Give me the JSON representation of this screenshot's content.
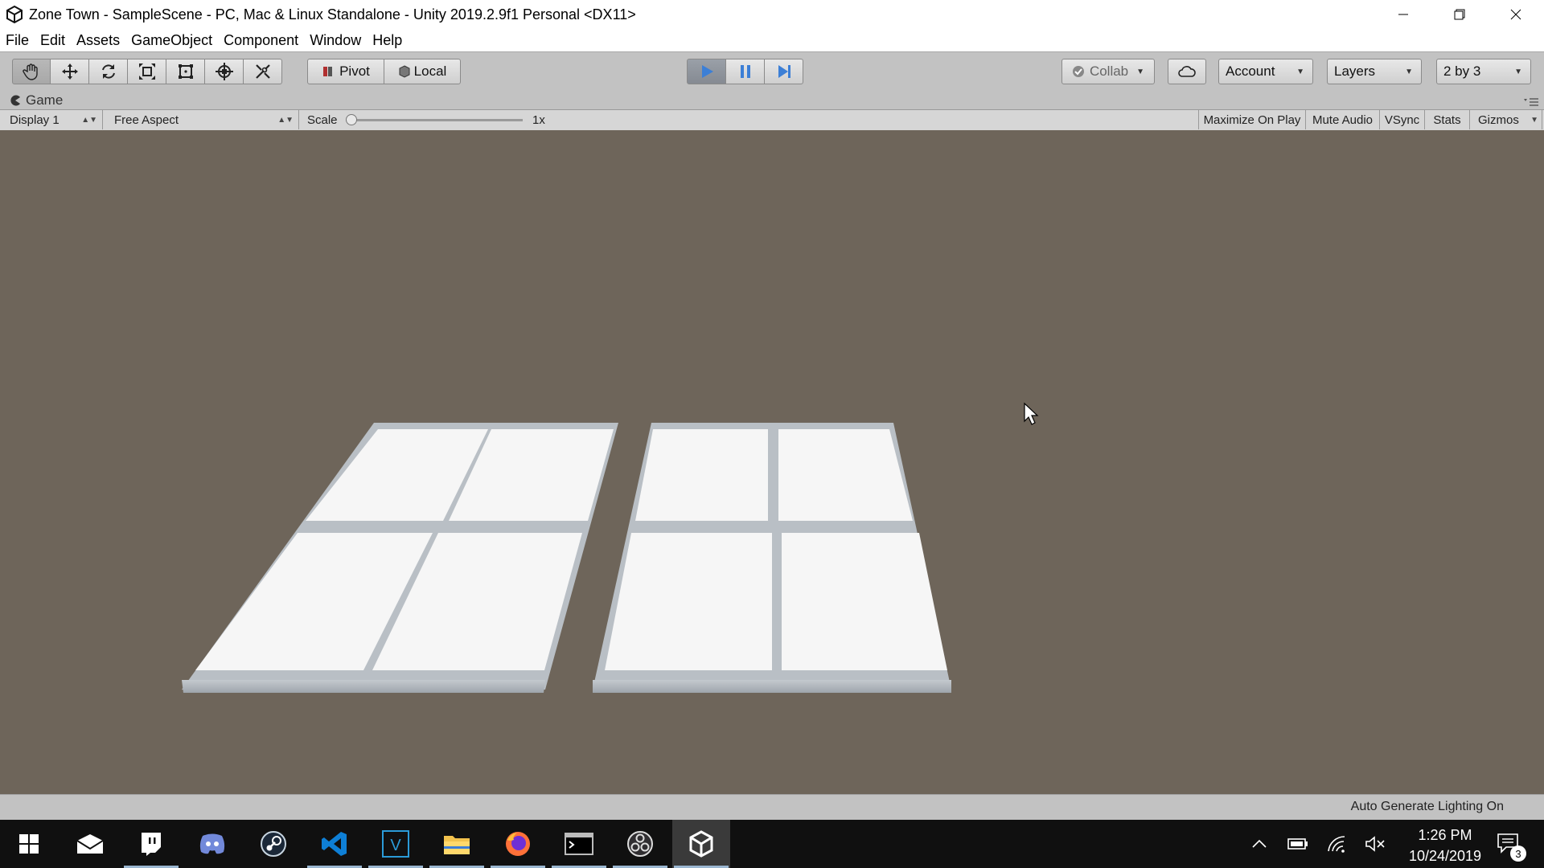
{
  "window": {
    "title": "Zone Town - SampleScene - PC, Mac & Linux Standalone - Unity 2019.2.9f1 Personal <DX11>",
    "controls": [
      "minimize-icon",
      "restore-icon",
      "close-icon"
    ]
  },
  "menu": [
    "File",
    "Edit",
    "Assets",
    "GameObject",
    "Component",
    "Window",
    "Help"
  ],
  "toolbar": {
    "tools": [
      "hand-tool-icon",
      "move-tool-icon",
      "rotate-tool-icon",
      "scale-tool-icon",
      "rect-tool-icon",
      "transform-tool-icon",
      "custom-tool-icon"
    ],
    "pivot_label": "Pivot",
    "local_label": "Local",
    "play_controls": [
      "play-icon",
      "pause-icon",
      "step-icon"
    ],
    "collab_label": "Collab",
    "account_label": "Account",
    "layers_label": "Layers",
    "layout_label": "2 by 3"
  },
  "game_tab": {
    "label": "Game"
  },
  "game_toolbar": {
    "display": "Display 1",
    "aspect": "Free Aspect",
    "scale_label": "Scale",
    "scale_value": "1x",
    "scale_fraction": 0.0,
    "maximize_on_play": "Maximize On Play",
    "mute_audio": "Mute Audio",
    "vsync": "VSync",
    "stats": "Stats",
    "gizmos": "Gizmos"
  },
  "status": {
    "text": "Auto Generate Lighting On"
  },
  "colors": {
    "play_active": "#3c7fd6",
    "game_bg": "#6e655a",
    "tile": "#f6f6f6",
    "tile_edge": "#aeb4ba"
  },
  "taskbar": {
    "apps": [
      "windows-start-icon",
      "mail-icon",
      "twitch-icon",
      "discord-icon",
      "steam-icon",
      "vscode-icon",
      "v-app-icon",
      "file-explorer-icon",
      "firefox-icon",
      "terminal-icon",
      "obs-icon",
      "unity-icon"
    ],
    "tray": [
      "chevron-up-icon",
      "battery-icon",
      "wifi-icon",
      "volume-muted-icon"
    ],
    "time": "1:26 PM",
    "date": "10/24/2019",
    "notifications": "3"
  }
}
